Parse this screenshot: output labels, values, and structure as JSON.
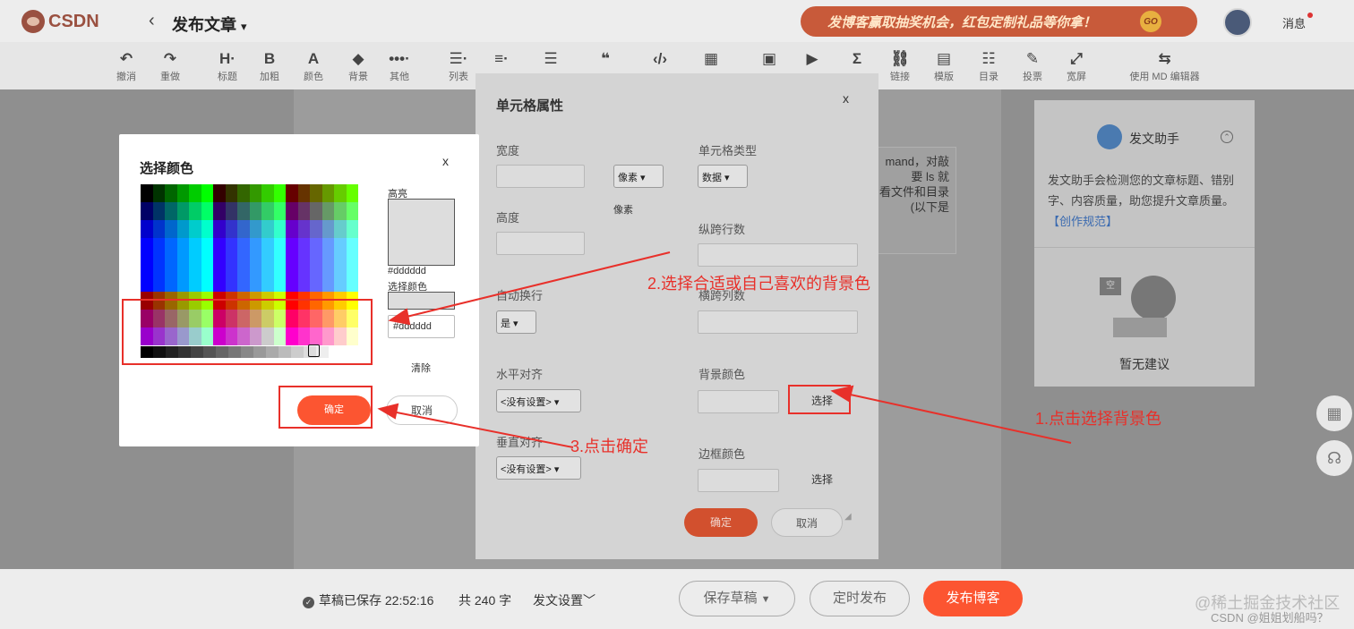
{
  "header": {
    "logo": "CSDN",
    "back": "‹",
    "title": "发布文章",
    "title_caret": "▾",
    "banner": "发博客赢取抽奖机会，红包定制礼品等你拿！",
    "banner_go": "GO",
    "messages": "消息"
  },
  "toolbar": [
    {
      "icon": "↶",
      "label": "撤消"
    },
    {
      "icon": "↷",
      "label": "重做"
    },
    {
      "icon": "H·",
      "label": "标题"
    },
    {
      "icon": "B",
      "label": "加粗"
    },
    {
      "icon": "A",
      "label": "颜色"
    },
    {
      "icon": "◆",
      "label": "背景"
    },
    {
      "icon": "•••·",
      "label": "其他"
    },
    {
      "icon": "☰·",
      "label": "列表"
    },
    {
      "icon": "≡·",
      "label": ""
    },
    {
      "icon": "☰",
      "label": ""
    },
    {
      "icon": "❝",
      "label": ""
    },
    {
      "icon": "‹/›",
      "label": ""
    },
    {
      "icon": "▦",
      "label": ""
    },
    {
      "icon": "▣",
      "label": ""
    },
    {
      "icon": "▶",
      "label": ""
    },
    {
      "icon": "Σ",
      "label": ""
    },
    {
      "icon": "⛓",
      "label": "链接"
    },
    {
      "icon": "▤",
      "label": "模版"
    },
    {
      "icon": "☷",
      "label": "目录"
    },
    {
      "icon": "✎",
      "label": "投票"
    },
    {
      "icon": "⤢",
      "label": "宽屏"
    },
    {
      "icon": "⇆",
      "label": "使用 MD 编辑器"
    }
  ],
  "editor_text": [
    "mand，对敲",
    "要 ls 就",
    "看文件和目录",
    "(以下是"
  ],
  "assistant": {
    "title": "发文助手",
    "desc": "发文助手会检测您的文章标题、错别字、内容质量，助您提升文章质量。",
    "link": "【创作规范】",
    "empty": "暂无建议",
    "empty_badge": "空"
  },
  "cell_modal": {
    "title": "单元格属性",
    "close": "x",
    "width_label": "宽度",
    "unit": "像素",
    "unit_label": "像素",
    "height_label": "高度",
    "cell_type_label": "单元格类型",
    "cell_type": "数据",
    "rowspan_label": "纵跨行数",
    "wrap_label": "自动换行",
    "wrap": "是",
    "colspan_label": "横跨列数",
    "halign_label": "水平对齐",
    "halign": "<没有设置>",
    "bg_label": "背景颜色",
    "bg_choose": "选择",
    "valign_label": "垂直对齐",
    "valign": "<没有设置>",
    "border_label": "边框颜色",
    "border_choose": "选择",
    "ok": "确定",
    "cancel": "取消"
  },
  "color_modal": {
    "title": "选择颜色",
    "close": "x",
    "highlight_label": "高亮",
    "highlight_value": "#dddddd",
    "selected_label": "选择颜色",
    "input_value": "#dddddd",
    "clear": "清除",
    "ok": "确定",
    "cancel": "取消"
  },
  "annotations": {
    "step1": "1.点击选择背景色",
    "step2": "2.选择合适或自己喜欢的背景色",
    "step3": "3.点击确定"
  },
  "bottom": {
    "saved": "草稿已保存 22:52:16",
    "count": "共 240 字",
    "settings": "发文设置",
    "save_draft": "保存草稿",
    "schedule": "定时发布",
    "publish": "发布博客"
  },
  "watermark": {
    "line1": "@稀土掘金技术社区",
    "line2": "CSDN @姐姐划船吗？"
  },
  "colors": {
    "accent": "#fc5531",
    "annotation": "#e8302a",
    "highlight": "#dddddd"
  }
}
